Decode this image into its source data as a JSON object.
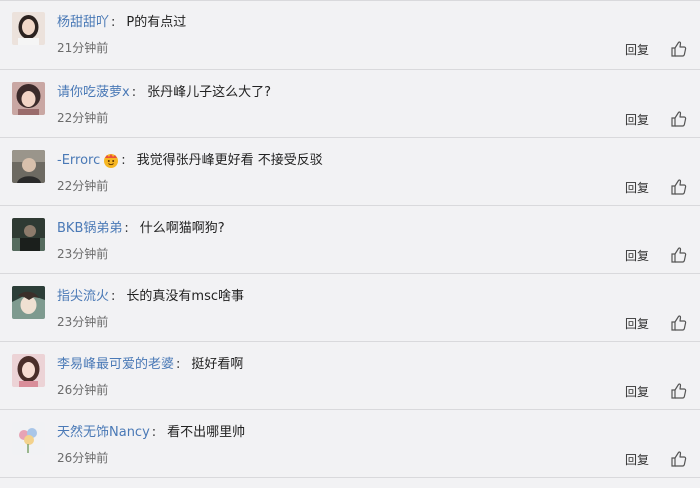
{
  "comments": [
    {
      "user": "杨甜甜吖",
      "text": "P的有点过",
      "time": "21分钟前",
      "avatar": "avatar-girl-icon",
      "avatar_bg": "#e8d9d2"
    },
    {
      "user": "请你吃菠萝x",
      "text": "张丹峰儿子这么大了?",
      "time": "22分钟前",
      "avatar": "avatar-girl-dark-hair-icon",
      "avatar_bg": "#c9a7a3"
    },
    {
      "user": "-Errorc",
      "text": "我觉得张丹峰更好看 不接受反驳",
      "time": "22分钟前",
      "avatar": "avatar-person-dark-icon",
      "avatar_bg": "#6d6a62",
      "badge": "smiley-badge-icon"
    },
    {
      "user": "BKB锅弟弟",
      "text": "什么啊猫啊狗?",
      "time": "23分钟前",
      "avatar": "avatar-dark-photo-icon",
      "avatar_bg": "#3e4a42"
    },
    {
      "user": "指尖流火",
      "text": "长的真没有msc啥事",
      "time": "23分钟前",
      "avatar": "avatar-anime-icon",
      "avatar_bg": "#8aa39a"
    },
    {
      "user": "李易峰最可爱的老婆",
      "text": "挺好看啊",
      "time": "26分钟前",
      "avatar": "avatar-girl-pink-icon",
      "avatar_bg": "#e5c2c6"
    },
    {
      "user": "天然无饰Nancy",
      "text": "看不出哪里帅",
      "time": "26分钟前",
      "avatar": "avatar-flower-icon",
      "avatar_bg": "#eef0f2"
    }
  ],
  "reply_label": "回复",
  "like_icon": "thumbs-up-icon",
  "colors": {
    "username": "#4a79b6",
    "background": "#f2f2f4",
    "divider": "#d9d9dc"
  }
}
